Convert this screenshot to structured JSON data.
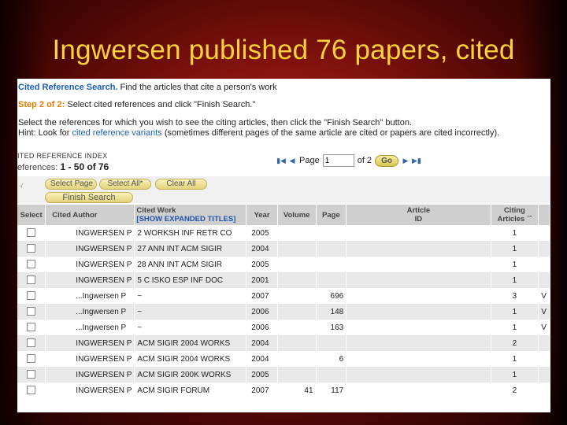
{
  "slide": {
    "title": "Ingwersen published 76 papers, cited"
  },
  "header": {
    "line1_label": "Cited Reference Search.",
    "line1_text": " Find the articles that cite a person's work",
    "step_label": "Step 2 of 2:",
    "step_text": " Select cited references and click \"Finish Search.\"",
    "instruction": "Select the references for which you wish to see the citing articles, then click the \"Finish Search\" button.",
    "hint_prefix": "Hint: Look for ",
    "hint_link": "cited reference variants",
    "hint_suffix": " (sometimes different pages of the same article are cited or papers are cited incorrectly)."
  },
  "index": {
    "header": "ITED REFERENCE INDEX",
    "count_prefix": "eferences:",
    "count_range": "1 - 50 of",
    "count_total": "76"
  },
  "pager": {
    "page_label": "Page",
    "page_value": "1",
    "of_text": "of 2",
    "go_label": "Go"
  },
  "buttons": {
    "select_page": "Select Page",
    "select_all": "Select All*",
    "clear_all": "Clear All",
    "finish_search": "Finish Search",
    "marker": "·/"
  },
  "table": {
    "headers": {
      "select": "Select",
      "cited_author": "Cited Author",
      "cited_work": "Cited Work",
      "expanded_titles": "[SHOW EXPANDED TITLES]",
      "year": "Year",
      "volume": "Volume",
      "page": "Page",
      "article_id_1": "Article",
      "article_id_2": "ID",
      "citing_1": "Citing",
      "citing_2": "Articles ´ˆ"
    },
    "rows": [
      {
        "author": "INGWERSEN P",
        "work": "2 WORKSH INF RETR CO",
        "year": "2005",
        "volume": "",
        "page": "",
        "article_id": "",
        "citing": "1",
        "extra": ""
      },
      {
        "author": "INGWERSEN P",
        "work": "27 ANN INT ACM SIGIR",
        "year": "2004",
        "volume": "",
        "page": "",
        "article_id": "",
        "citing": "1",
        "extra": ""
      },
      {
        "author": "INGWERSEN P",
        "work": "28 ANN INT ACM SIGIR",
        "year": "2005",
        "volume": "",
        "page": "",
        "article_id": "",
        "citing": "1",
        "extra": ""
      },
      {
        "author": "INGWERSEN P",
        "work": "5 C ISKO ESP INF DOC",
        "year": "2001",
        "volume": "",
        "page": "",
        "article_id": "",
        "citing": "1",
        "extra": ""
      },
      {
        "author": "...Ingwersen P",
        "work": "~",
        "year": "2007",
        "volume": "",
        "page": "696",
        "article_id": "",
        "citing": "3",
        "extra": "V"
      },
      {
        "author": "...Ingwersen P",
        "work": "~",
        "year": "2006",
        "volume": "",
        "page": "148",
        "article_id": "",
        "citing": "1",
        "extra": "V"
      },
      {
        "author": "...Ingwersen P",
        "work": "~",
        "year": "2006",
        "volume": "",
        "page": "163",
        "article_id": "",
        "citing": "1",
        "extra": "V"
      },
      {
        "author": "INGWERSEN P",
        "work": "ACM SIGIR 2004 WORKS",
        "year": "2004",
        "volume": "",
        "page": "",
        "article_id": "",
        "citing": "2",
        "extra": ""
      },
      {
        "author": "INGWERSEN P",
        "work": "ACM SIGIR 2004 WORKS",
        "year": "2004",
        "volume": "",
        "page": "6",
        "article_id": "",
        "citing": "1",
        "extra": ""
      },
      {
        "author": "INGWERSEN P",
        "work": "ACM SIGIR 200K WORKS",
        "year": "2005",
        "volume": "",
        "page": "",
        "article_id": "",
        "citing": "1",
        "extra": ""
      },
      {
        "author": "INGWERSEN P",
        "work": "ACM SIGIR FORUM",
        "year": "2007",
        "volume": "41",
        "page": "117",
        "article_id": "",
        "citing": "2",
        "extra": ""
      }
    ]
  }
}
